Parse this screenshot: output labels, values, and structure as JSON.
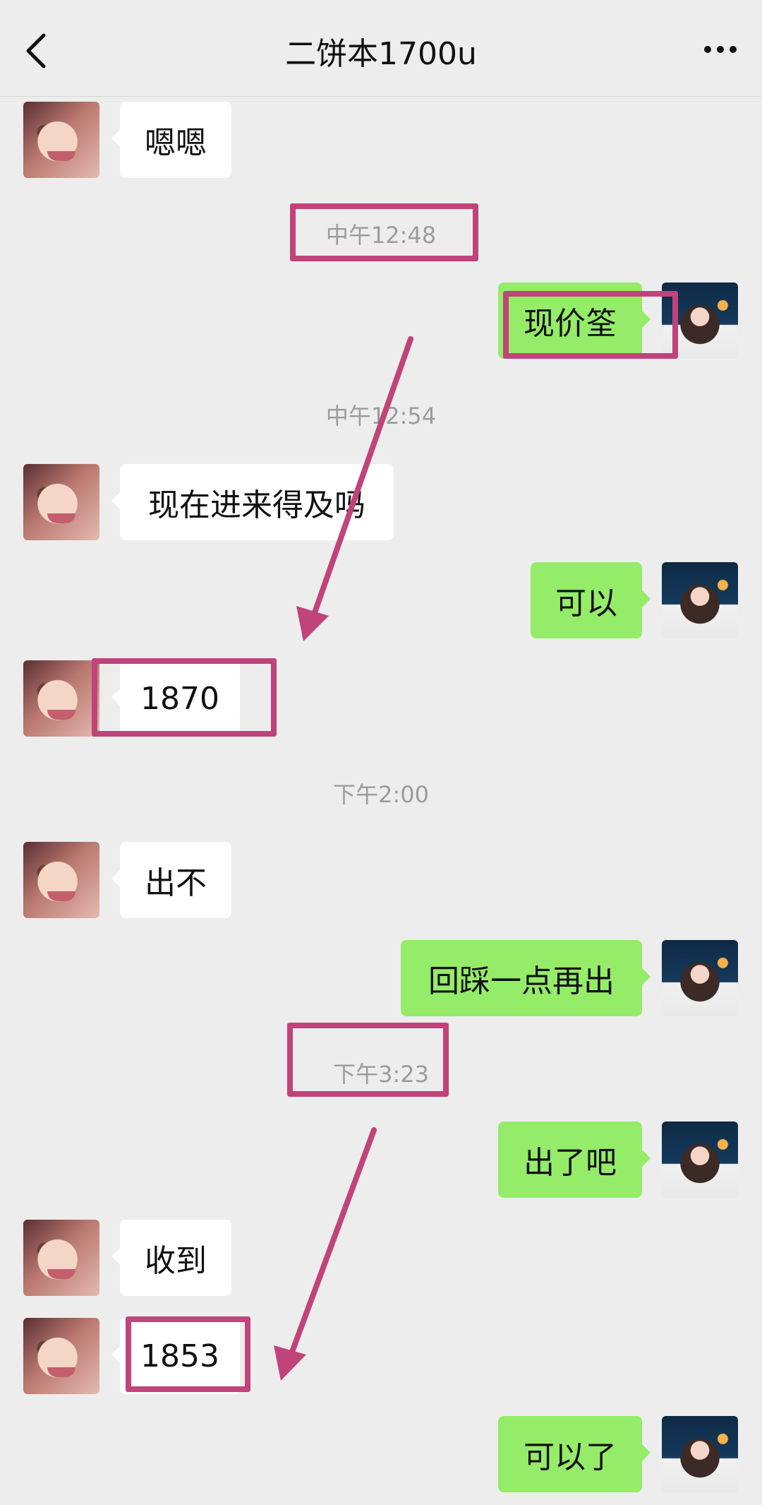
{
  "header": {
    "back_icon": "chevron-left-icon",
    "title": "二饼本1700u",
    "more_icon": "more-horizontal-icon"
  },
  "messages": [
    {
      "side": "left",
      "text": "嗯嗯"
    },
    {
      "type": "time",
      "text": "中午12:48"
    },
    {
      "side": "right",
      "text": "现价筌"
    },
    {
      "type": "time",
      "text": "中午12:54"
    },
    {
      "side": "left",
      "text": "现在进来得及吗"
    },
    {
      "side": "right",
      "text": "可以"
    },
    {
      "side": "left",
      "text": "1870"
    },
    {
      "type": "time",
      "text": "下午2:00"
    },
    {
      "side": "left",
      "text": "出不"
    },
    {
      "side": "right",
      "text": "回踩一点再出"
    },
    {
      "type": "time",
      "text": "下午3:23"
    },
    {
      "side": "right",
      "text": "出了吧"
    },
    {
      "side": "left",
      "text": "收到"
    },
    {
      "side": "left",
      "text": "1853"
    },
    {
      "side": "right",
      "text": "可以了"
    }
  ],
  "colors": {
    "background": "#ededed",
    "bubble_self": "#95ec69",
    "bubble_other": "#ffffff",
    "annotation": "#c0437a"
  }
}
